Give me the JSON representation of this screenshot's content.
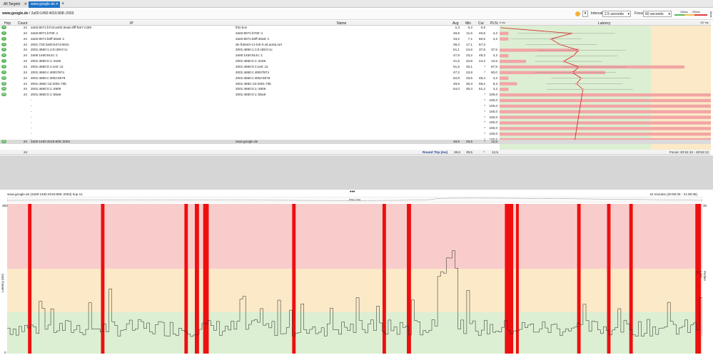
{
  "tabs": [
    {
      "label": "All Targets",
      "active": false
    },
    {
      "label": "www.google.de",
      "active": true
    }
  ],
  "path": {
    "host": "www.google.de",
    "ip": "/ 2a00:1450:4016:808::2003"
  },
  "controls": {
    "interval_label": "Interval",
    "interval_value": "2.5 seconds",
    "focus_label": "Focus",
    "focus_value": "60 seconds",
    "scale_100": "100ms",
    "scale_200": "200ms",
    "scale_alerts": "Alerts"
  },
  "columns": {
    "hop": "Hop",
    "count": "Count",
    "ip": "IP",
    "name": "Name",
    "avg": "Avg",
    "min": "Min",
    "cur": "Cur",
    "pl": "PL%",
    "latency": "Latency",
    "lat_min": "0 ms",
    "lat_max": "137 ms"
  },
  "hops": [
    {
      "hop": "1",
      "count": "24",
      "ip": "2a02:8071:b7c8:a400:3ea6:2fff:fe57:c339",
      "name": "fritz.box",
      "avg": "1,3",
      "min": "0,2",
      "cur": "0,5",
      "pl": ""
    },
    {
      "hop": "2",
      "count": "24",
      "ip": "2a02:8071:b700::1",
      "name": "2a02:8071:b700::1",
      "avg": "46,9",
      "min": "11,6",
      "cur": "40,8",
      "pl": "4,2"
    },
    {
      "hop": "3",
      "count": "24",
      "ip": "2a02:8071:b0ff:30a9::1",
      "name": "2a02:8071:b0ff:30a9::1",
      "avg": "33,2",
      "min": "7,1",
      "cur": "60,5",
      "pl": "4,2"
    },
    {
      "hop": "4",
      "count": "24",
      "ip": "2001:730:2a00:5474:8015",
      "name": "de-fra04d-rc1-lo0-0.v6.aorta.net",
      "avg": "39,3",
      "min": "17,1",
      "cur": "57,3",
      "pl": ""
    },
    {
      "hop": "5",
      "count": "24",
      "ip": "2001:4860:1:1:0:c89:0:1c",
      "name": "2001:4860:1:1:0:c89:0:1c",
      "avg": "51,1",
      "min": "24,6",
      "cur": "37,8",
      "pl": "37,5"
    },
    {
      "hop": "6",
      "count": "24",
      "ip": "2a00:1450:814c::1",
      "name": "2a00:1450:814c::1",
      "avg": "47,8",
      "min": "23,2",
      "cur": "49,3",
      "pl": "4,2"
    },
    {
      "hop": "7",
      "count": "24",
      "ip": "2001:4860:0:1::3166",
      "name": "2001:4860:0:1::3166",
      "avg": "41,5",
      "min": "22,8",
      "cur": "44,4",
      "pl": "12,5"
    },
    {
      "hop": "8",
      "count": "24",
      "ip": "2001:4860:0:1:1e0::11",
      "name": "2001:4860:0:1:1e0::11",
      "avg": "51,5",
      "min": "40,1",
      "cur": "*",
      "pl": "87,5"
    },
    {
      "hop": "9",
      "count": "24",
      "ip": "2001:4860:c:4000:f874",
      "name": "2001:4860:c:4000:f874",
      "avg": "47,2",
      "min": "22,8",
      "cur": "*",
      "pl": "50,0"
    },
    {
      "hop": "10",
      "count": "24",
      "ip": "2001:4860:c:4002:5b79",
      "name": "2001:4860:c:4002:5b79",
      "avg": "52,9",
      "min": "33,5",
      "cur": "48,4",
      "pl": "4,2"
    },
    {
      "hop": "11",
      "count": "24",
      "ip": "2001:4860::22:4001:70b",
      "name": "2001:4860::22:4001:70b",
      "avg": "49,9",
      "min": "30,3",
      "cur": "59,2",
      "pl": "8,3"
    },
    {
      "hop": "12",
      "count": "24",
      "ip": "2001:4860:0:1::4809",
      "name": "2001:4860:0:1::4809",
      "avg": "54,0",
      "min": "30,4",
      "cur": "51,2",
      "pl": "4,2"
    },
    {
      "hop": "13",
      "count": "24",
      "ip": "2001:4860:0:1::5ba9",
      "name": "2001:4860:0:1::5ba9",
      "avg": "",
      "min": "",
      "cur": "*",
      "pl": "100,0"
    },
    {
      "hop": "",
      "count": "",
      "ip": "-",
      "name": "",
      "avg": "",
      "min": "",
      "cur": "*",
      "pl": "100,0"
    },
    {
      "hop": "",
      "count": "",
      "ip": "-",
      "name": "",
      "avg": "",
      "min": "",
      "cur": "*",
      "pl": "100,0"
    },
    {
      "hop": "",
      "count": "",
      "ip": "-",
      "name": "",
      "avg": "",
      "min": "",
      "cur": "*",
      "pl": "100,0"
    },
    {
      "hop": "",
      "count": "",
      "ip": "-",
      "name": "",
      "avg": "",
      "min": "",
      "cur": "*",
      "pl": "100,0"
    },
    {
      "hop": "",
      "count": "",
      "ip": "-",
      "name": "",
      "avg": "",
      "min": "",
      "cur": "*",
      "pl": "100,0"
    },
    {
      "hop": "",
      "count": "",
      "ip": "-",
      "name": "",
      "avg": "",
      "min": "",
      "cur": "*",
      "pl": "100,0"
    },
    {
      "hop": "",
      "count": "",
      "ip": "-",
      "name": "",
      "avg": "",
      "min": "",
      "cur": "*",
      "pl": "100,0"
    },
    {
      "hop": "",
      "count": "",
      "ip": "-",
      "name": "",
      "avg": "",
      "min": "",
      "cur": "*",
      "pl": "100,0"
    },
    {
      "hop": "22",
      "count": "24",
      "ip": "2a00:1450:4016:808::2003",
      "name": "www.google.de",
      "avg": "48,6",
      "min": "29,5",
      "cur": "*",
      "pl": "12,5"
    }
  ],
  "summary": {
    "count": "24",
    "label": "Round Trip (ms)",
    "avg": "48,6",
    "min": "29,5",
    "cur": "*",
    "pl": "12,5",
    "focus": "Focus: 20:51:13 - 20:52:13"
  },
  "timeline": {
    "title": "www.google.de (2a00:1450:4016:808::2003) hop 14",
    "range": "10 minutes (20:58:35 - 21:08:35)",
    "ylabel": "Latency (ms)",
    "y2label": "Packet Loss %",
    "mini_label": "PNK DNI",
    "y_ticks": [
      "350",
      "",
      "",
      "",
      "",
      "0"
    ],
    "y_right": [
      "30",
      ""
    ],
    "x_ticks": [
      "20:58:40",
      "20:59",
      "20:59:20",
      "20:59:40",
      "21:00",
      "21:00:20",
      "21:00:40",
      "21:01",
      "21:01:20",
      "21:01:40",
      "21:02:00",
      "21:02:20",
      "21:02:40",
      "21:03:00",
      "21:03:20",
      "21:03:40",
      "21:04:00",
      "21:04:20",
      "21:04:40",
      "21:05:00",
      "21:05:20",
      "21:05:40",
      "21:06:00",
      "21:06:20",
      "21:06:40",
      "21:07:00",
      "21:07:20",
      "21:07:40",
      "21:08:00",
      "21:08:20"
    ]
  },
  "colors": {
    "green_zone": "#dcefd2",
    "yellow_zone": "#fbe9c8",
    "red_zone": "#f9cccc",
    "loss_bar": "#ee0f0f",
    "accent": "#1e73c8"
  }
}
